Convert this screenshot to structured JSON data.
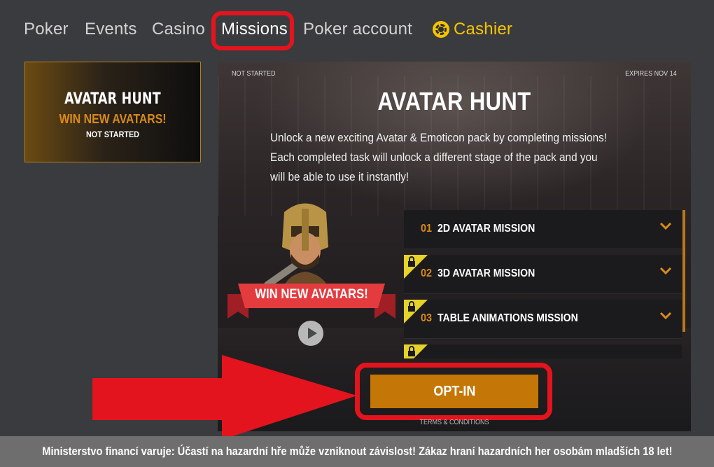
{
  "nav": {
    "items": [
      {
        "label": "Poker"
      },
      {
        "label": "Events"
      },
      {
        "label": "Casino"
      },
      {
        "label": "Missions"
      },
      {
        "label": "Poker account"
      },
      {
        "label": "Cashier",
        "icon": "chip-icon"
      }
    ],
    "active": "Missions"
  },
  "sidebar": {
    "card": {
      "title": "AVATAR HUNT",
      "subtitle": "WIN NEW AVATARS!",
      "status": "NOT STARTED"
    }
  },
  "panel": {
    "status": "NOT STARTED",
    "expires": "EXPIRES NOV 14",
    "title": "AVATAR HUNT",
    "description": "Unlock a new exciting Avatar & Emoticon pack by completing missions! Each completed task will unlock a different stage of the pack and you will be able to use it instantly!",
    "ribbon": "WIN NEW AVATARS!",
    "missions": [
      {
        "num": "01",
        "name": "2D AVATAR MISSION",
        "locked": false
      },
      {
        "num": "02",
        "name": "3D AVATAR MISSION",
        "locked": true
      },
      {
        "num": "03",
        "name": "TABLE ANIMATIONS MISSION",
        "locked": true
      },
      {
        "num": "",
        "name": "",
        "locked": true
      }
    ],
    "opt_in": "OPT-IN",
    "terms": "TERMS & CONDITIONS"
  },
  "warning": "Ministerstvo financí varuje: Účastí na hazardní hře může vzniknout závislost! Zákaz hraní hazardních her osobám mladších 18 let!",
  "colors": {
    "accent": "#c47706",
    "cashier": "#f6c500",
    "highlight": "#e3141e"
  }
}
